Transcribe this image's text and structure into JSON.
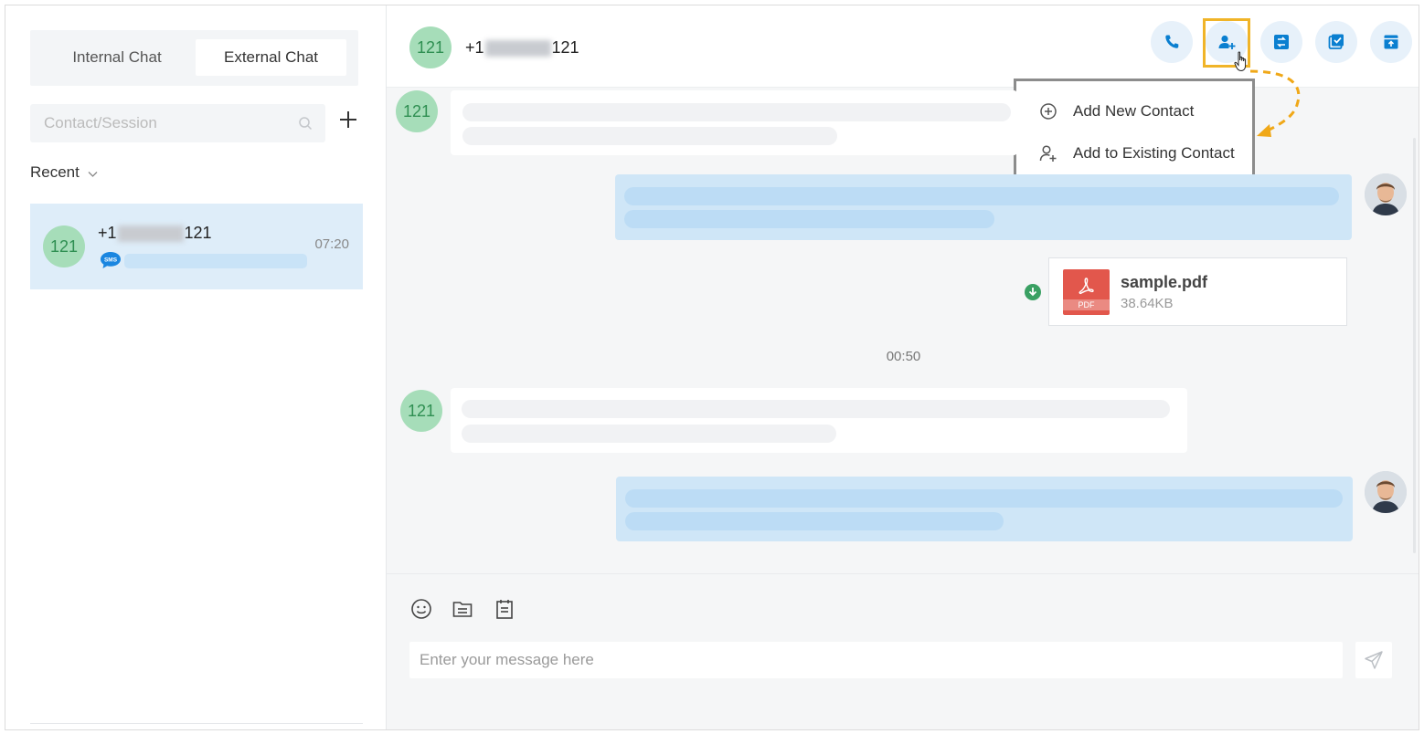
{
  "sidebar": {
    "tabs": [
      {
        "label": "Internal Chat",
        "active": false
      },
      {
        "label": "External Chat",
        "active": true
      }
    ],
    "search_placeholder": "Contact/Session",
    "recent_label": "Recent",
    "sessions": [
      {
        "avatar_text": "121",
        "phone_prefix": "+1",
        "phone_suffix": "121",
        "time": "07:20",
        "channel_icon": "sms-icon"
      }
    ]
  },
  "chat": {
    "header": {
      "avatar_text": "121",
      "phone_prefix": "+1",
      "phone_suffix": "121",
      "actions": [
        "call-icon",
        "add-contact-icon",
        "transfer-icon",
        "close-session-icon",
        "archive-icon"
      ]
    },
    "contact_menu": {
      "items": [
        {
          "label": "Add New Contact",
          "icon": "plus-circle-icon"
        },
        {
          "label": "Add to Existing Contact",
          "icon": "user-plus-icon"
        }
      ]
    },
    "messages": {
      "incoming_avatar_text": "121",
      "file": {
        "name": "sample.pdf",
        "size": "38.64KB",
        "type_label": "PDF"
      },
      "timestamp": "00:50"
    },
    "composer": {
      "placeholder": "Enter your message here",
      "tools": [
        "emoji-icon",
        "file-icon",
        "template-icon"
      ]
    }
  },
  "colors": {
    "accent": "#0a7fd0",
    "highlight": "#f0b428",
    "avatar_bg": "#a6ddb9",
    "avatar_text": "#2f8f52",
    "outgoing_bubble": "#cfe6f7"
  }
}
